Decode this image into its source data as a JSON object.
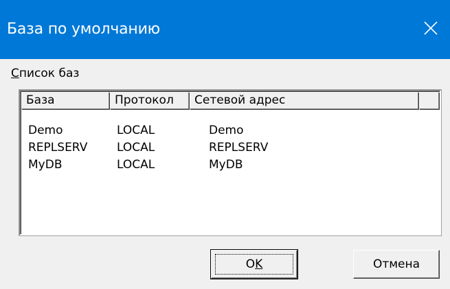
{
  "window": {
    "title": "База по умолчанию",
    "accent_color": "#0078d7"
  },
  "close_icon": "close-icon",
  "group": {
    "label_accel": "С",
    "label_rest": "писок баз"
  },
  "table": {
    "columns": [
      "База",
      "Протокол",
      "Сетевой адрес"
    ],
    "rows": [
      [
        "Demo",
        "LOCAL",
        "Demo"
      ],
      [
        "REPLSERV",
        "LOCAL",
        "REPLSERV"
      ],
      [
        "MyDB",
        "LOCAL",
        "MyDB"
      ]
    ]
  },
  "buttons": {
    "ok_prefix": "O",
    "ok_accel": "K",
    "cancel_label": "Отмена"
  }
}
